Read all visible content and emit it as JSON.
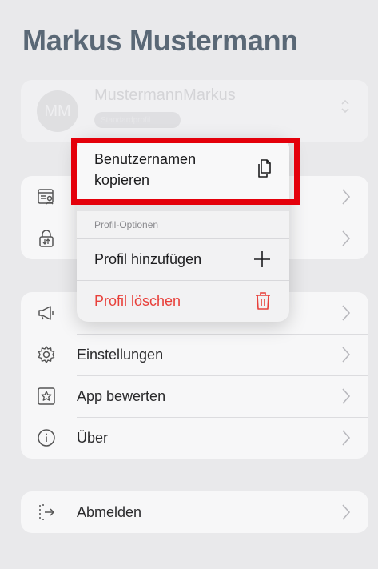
{
  "header": {
    "title": "Markus Mustermann"
  },
  "profile": {
    "avatar_initials": "MM",
    "username": "MustermannMarkus",
    "badge": "Standardprofil"
  },
  "section1": {
    "rows": [
      {
        "icon": "id-card-icon"
      },
      {
        "icon": "lock-arrows-icon"
      }
    ]
  },
  "section2": {
    "rows": [
      {
        "icon": "megaphone-icon"
      },
      {
        "icon": "gear-icon",
        "label": "Einstellungen"
      },
      {
        "icon": "star-square-icon",
        "label": "App bewerten"
      },
      {
        "icon": "info-icon",
        "label": "Über"
      }
    ]
  },
  "section3": {
    "rows": [
      {
        "icon": "logout-icon",
        "label": "Abmelden"
      }
    ]
  },
  "context_menu": {
    "copy_label": "Benutzernamen kopieren",
    "section_label": "Profil-Optionen",
    "add_label": "Profil hinzufügen",
    "delete_label": "Profil löschen"
  },
  "colors": {
    "title": "#5a6876",
    "danger": "#e8403a",
    "highlight": "#e4000b",
    "background": "#e9e9eb"
  }
}
